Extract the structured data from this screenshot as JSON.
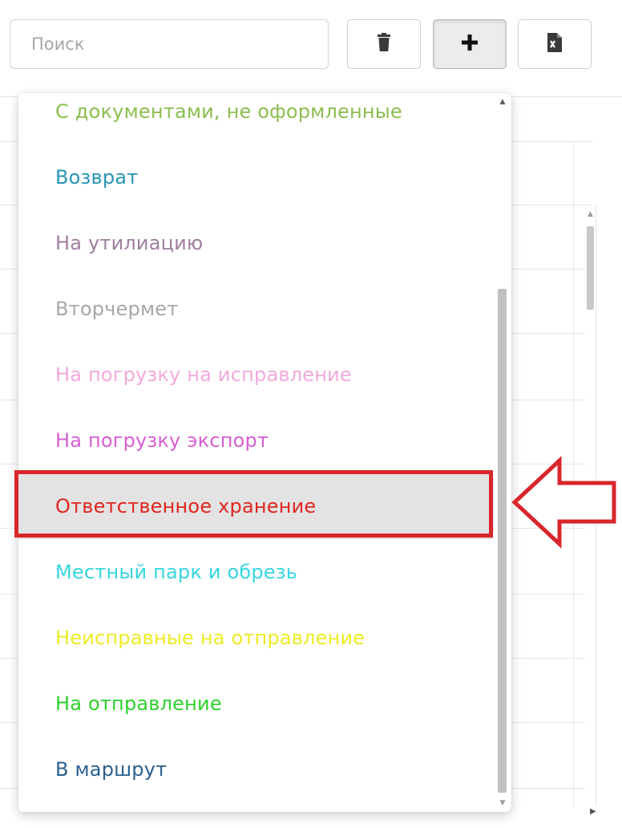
{
  "toolbar": {
    "search_placeholder": "Поиск",
    "buttons": [
      {
        "name": "delete-button",
        "icon": "trash-icon"
      },
      {
        "name": "add-button",
        "icon": "plus-icon"
      },
      {
        "name": "export-excel-button",
        "icon": "excel-file-icon"
      }
    ]
  },
  "dropdown": {
    "items": [
      {
        "label": "С документами, не оформленные",
        "color": "#8bbd4e"
      },
      {
        "label": "Возврат",
        "color": "#2796b5"
      },
      {
        "label": "На утилиацию",
        "color": "#9e7f9e"
      },
      {
        "label": "Вторчермет",
        "color": "#a7a7a7"
      },
      {
        "label": "На погрузку на исправление",
        "color": "#f2a9dc"
      },
      {
        "label": "На погрузку экспорт",
        "color": "#d75ed1"
      },
      {
        "label": "Ответственное хранение",
        "color": "#e0261f",
        "selected": true
      },
      {
        "label": "Местный парк и обрезь",
        "color": "#37d6de"
      },
      {
        "label": "Неисправные на отправление",
        "color": "#ecec26"
      },
      {
        "label": "На отправление",
        "color": "#2ed12e"
      },
      {
        "label": "В маршрут",
        "color": "#2a5f8e"
      }
    ]
  },
  "annotation": {
    "color": "#d9262c",
    "arrow_direction": "left",
    "target": "Ответственное хранение"
  }
}
